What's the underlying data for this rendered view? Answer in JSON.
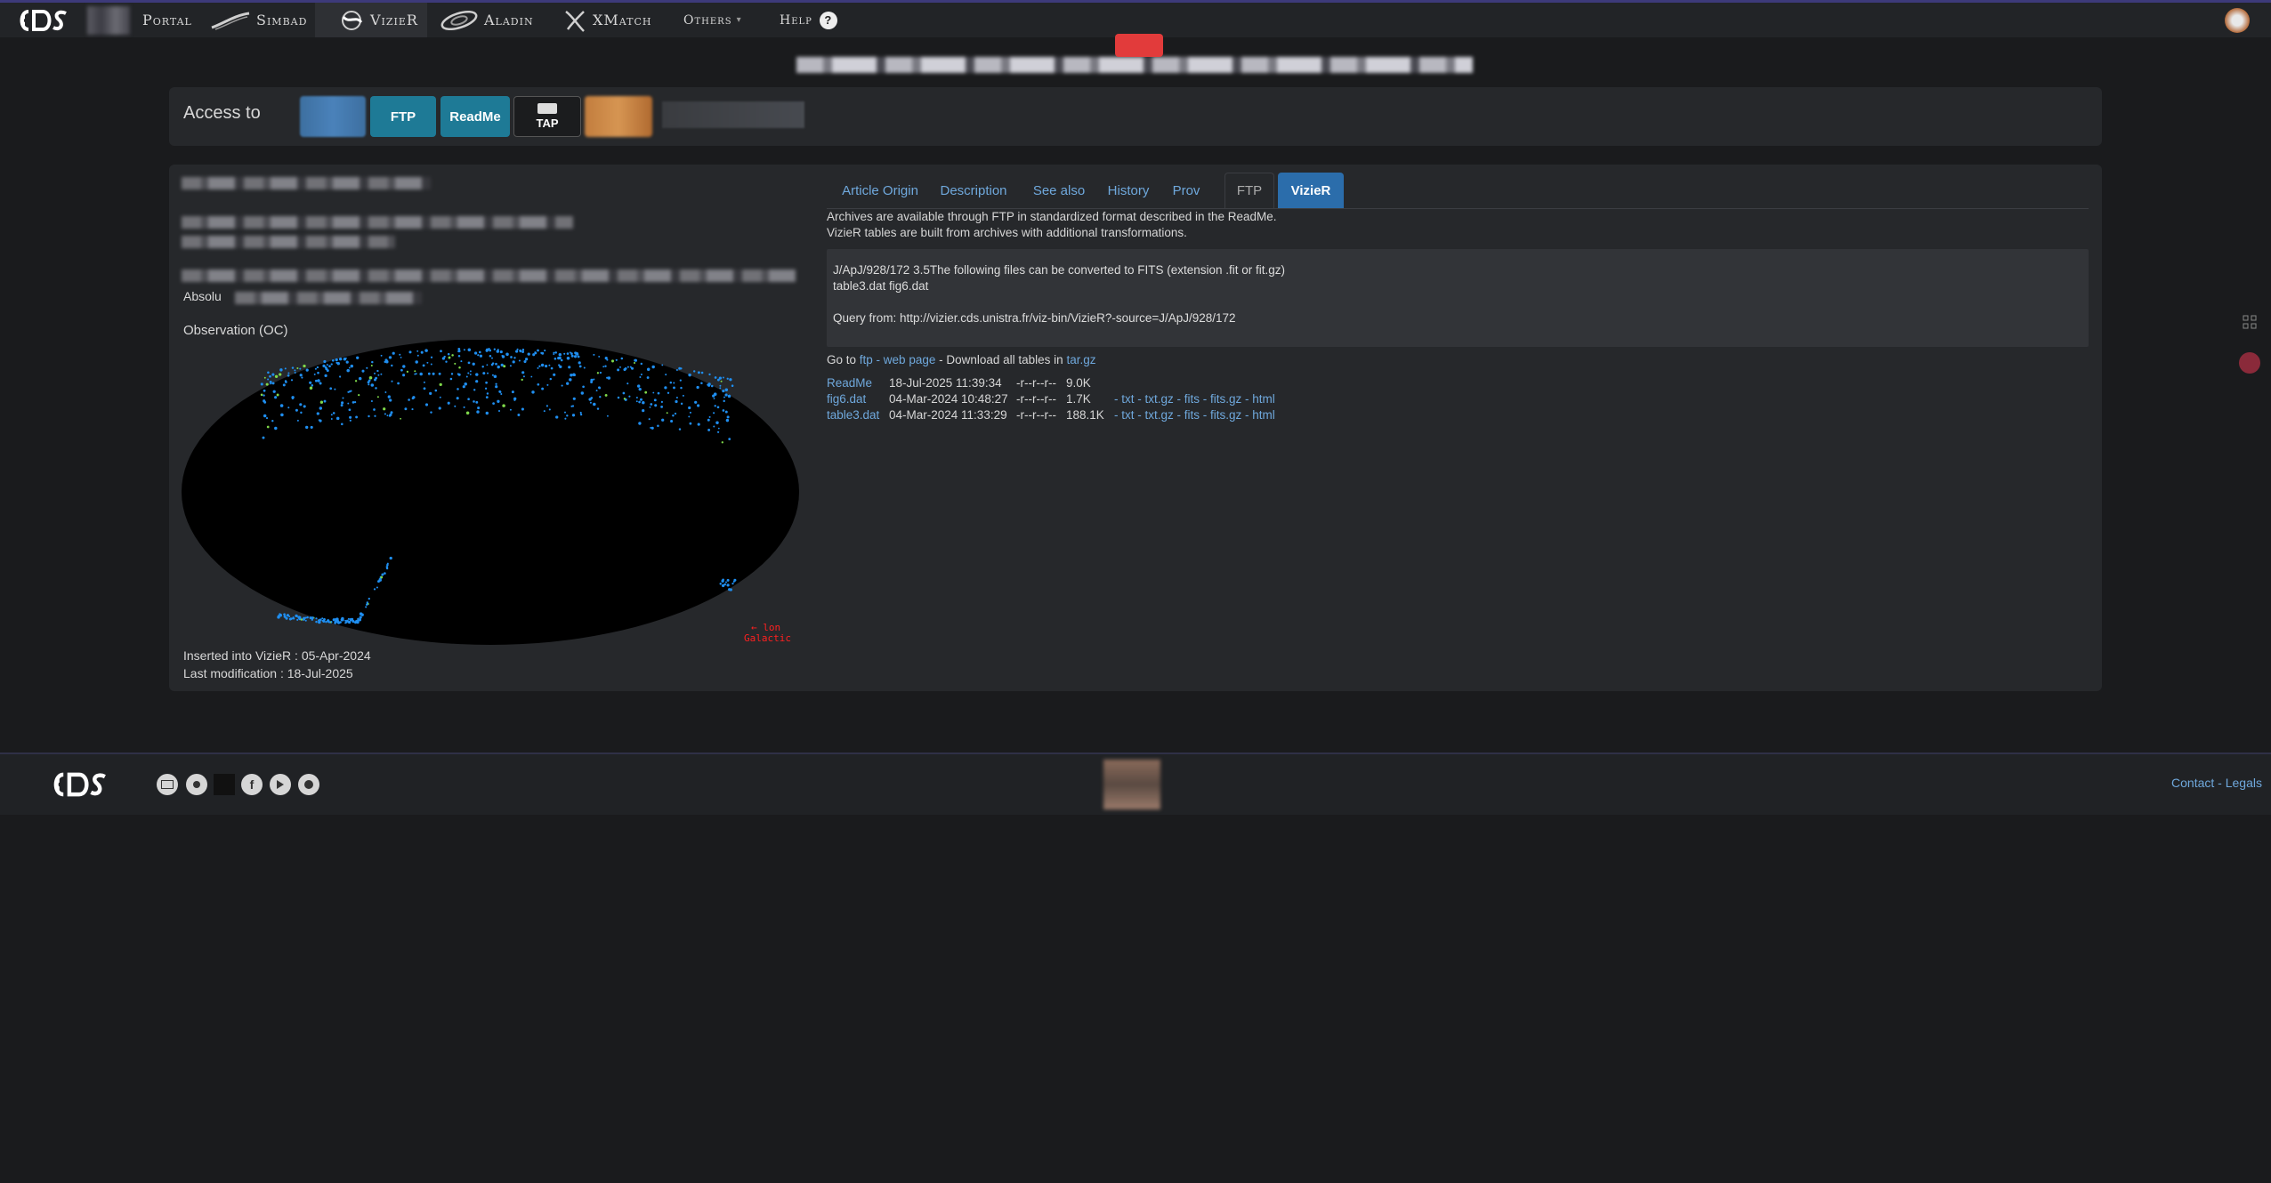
{
  "nav": {
    "portal": "Portal",
    "simbad": "Simbad",
    "vizier": "VizieR",
    "aladin": "Aladin",
    "xmatch": "XMatch",
    "others": "Others",
    "help": "Help",
    "help_icon": "?",
    "logo": "CDS"
  },
  "access": {
    "label": "Access to",
    "ftp": "FTP",
    "readme": "ReadMe",
    "tap": "TAP"
  },
  "left": {
    "absolute_prefix": "Absolu",
    "observation_label": "Observation (OC)",
    "map_axis": "lon",
    "map_frame": "Galactic",
    "inserted_label": "Inserted into VizieR : ",
    "inserted_date": "05-Apr-2024",
    "modified_label": "Last modification : ",
    "modified_date": "18-Jul-2025"
  },
  "tabs": [
    "Article Origin",
    "Description",
    "See also",
    "History",
    "Prov",
    "FTP",
    "VizieR"
  ],
  "ftp_panel": {
    "intro1": "Archives are available through FTP in standardized format described in the ReadMe.",
    "intro2": "VizieR tables are built from archives with additional transformations.",
    "code_line1": "J/ApJ/928/172 3.5The following files can be converted to FITS (extension .fit or fit.gz)",
    "code_line2": "table3.dat fig6.dat",
    "code_line3": "Query from: http://vizier.cds.unistra.fr/viz-bin/VizieR?-source=J/ApJ/928/172",
    "goto_prefix": "Go to ",
    "goto_ftp": "ftp",
    "goto_sep1": " - ",
    "goto_web": "web page",
    "goto_sep2": " - Download all tables in ",
    "goto_tar": "tar.gz",
    "files": [
      {
        "name": "ReadMe",
        "date": "18-Jul-2025 11:39:34",
        "perm": "-r--r--r--",
        "size": "9.0K",
        "formats": ""
      },
      {
        "name": "fig6.dat",
        "date": "04-Mar-2024 10:48:27",
        "perm": "-r--r--r--",
        "size": "1.7K",
        "formats": "- txt - txt.gz - fits - fits.gz - html"
      },
      {
        "name": "table3.dat",
        "date": "04-Mar-2024 11:33:29",
        "perm": "-r--r--r--",
        "size": "188.1K",
        "formats": "- txt - txt.gz - fits - fits.gz - html"
      }
    ]
  },
  "footer": {
    "contact": "Contact",
    "sep": " - ",
    "legals": "Legals"
  },
  "colors": {
    "accent": "#2b6dab",
    "link": "#6fa8dc",
    "ftp_button": "#1e7a96",
    "map_points": "#1f8ef0",
    "map_label": "#ff2020"
  },
  "icons": [
    "cds-logo",
    "simbad-icon",
    "vizier-icon",
    "aladin-icon",
    "xmatch-icon",
    "chevron-down-icon",
    "help-icon",
    "avatar-icon",
    "tap-icon",
    "email-icon",
    "rss-icon",
    "facebook-icon",
    "youtube-icon",
    "github-icon",
    "apps-icon",
    "translate-icon"
  ]
}
